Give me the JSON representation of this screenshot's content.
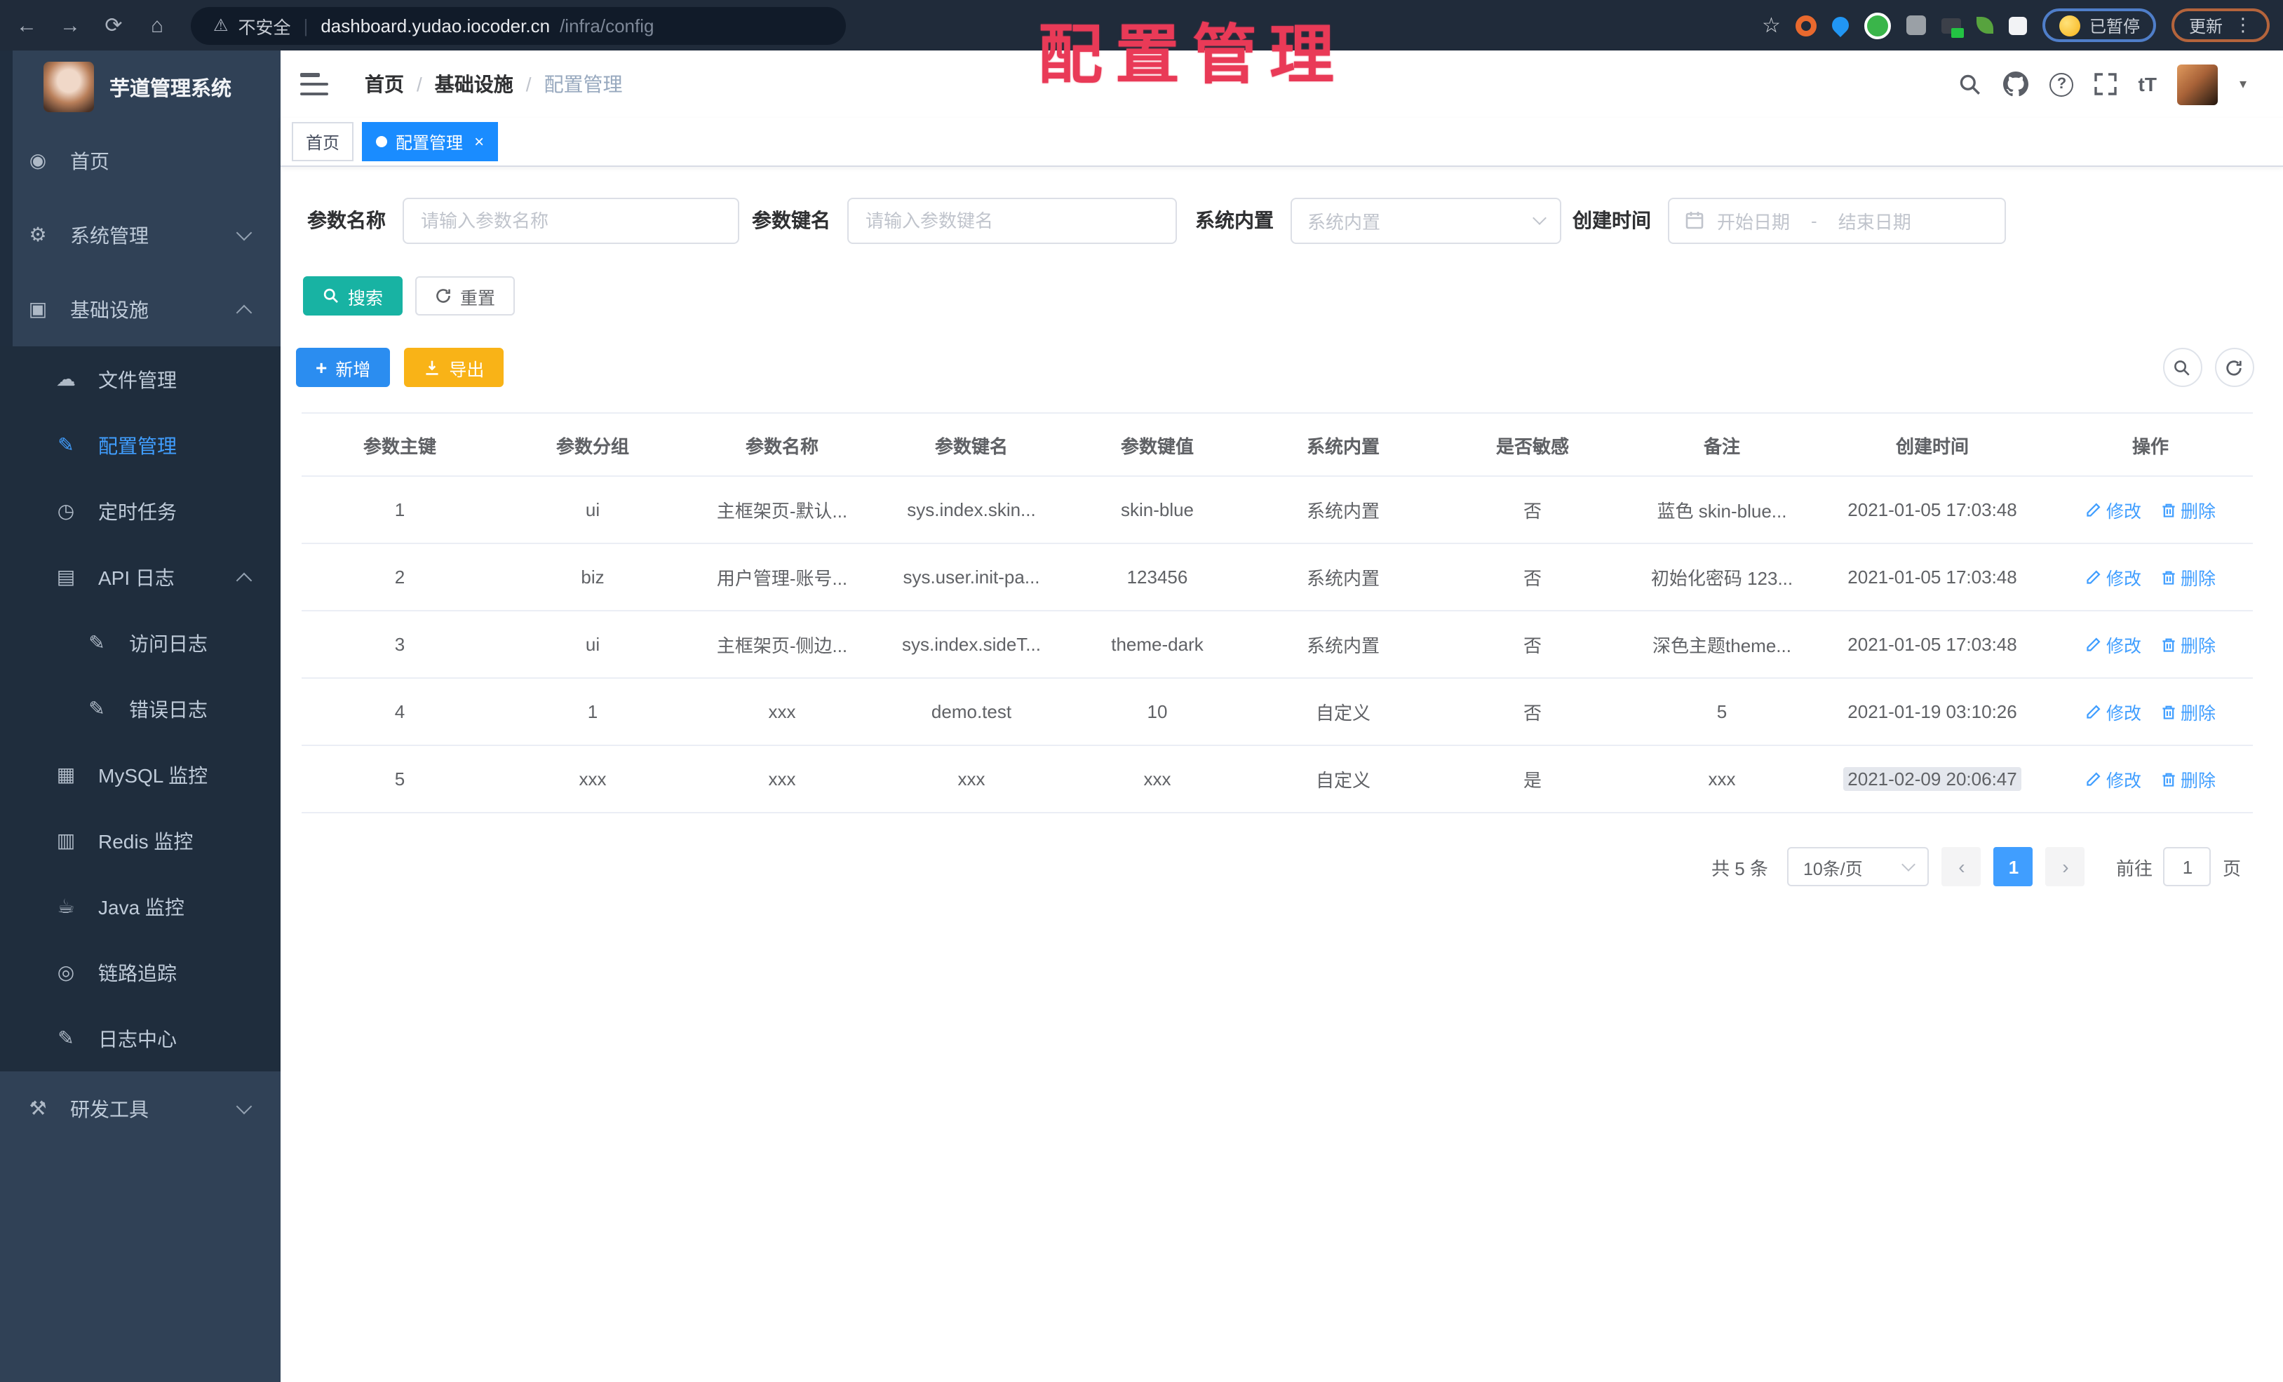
{
  "colors": {
    "accent": "#409eff",
    "tab-active": "#1a8cff",
    "btn-search": "#18b3a3",
    "btn-add": "#2b8df0",
    "btn-export": "#f9b317",
    "toolbar-bg": "#202b3a",
    "urlpill-bg": "#111b29",
    "sidebar-bg": "#304156",
    "sidebar-sub-bg": "#1f2d3d",
    "sidebar-text": "#bfcbd9",
    "stamp": "#e93a57",
    "link": "#409eff"
  },
  "icons": {
    "back": "←",
    "forward": "→",
    "reload": "⟳",
    "home": "⌂",
    "warning": "⚠",
    "star": "☆",
    "overflow": "⋮",
    "caret": "▾",
    "help": "?",
    "font_size": "tT",
    "plus": "+",
    "close": "×",
    "prev": "‹",
    "next": "›"
  },
  "browser": {
    "security_label": "不安全",
    "url_host": "dashboard.yudao.iocoder.cn",
    "url_path": "/infra/config",
    "paused_label": "已暂停",
    "update_label": "更新"
  },
  "stamp": "配置管理",
  "sidebar": {
    "title": "芋道管理系统",
    "items": [
      {
        "id": "home",
        "level": 1,
        "icon": "dashboard-icon",
        "glyph": "◉",
        "label": "首页"
      },
      {
        "id": "system",
        "level": 1,
        "icon": "gear-icon",
        "glyph": "⚙",
        "label": "系统管理",
        "chevron": "down"
      },
      {
        "id": "infra",
        "level": 1,
        "icon": "monitor-icon",
        "glyph": "▣",
        "label": "基础设施",
        "chevron": "up"
      },
      {
        "id": "file",
        "level": 2,
        "sub": true,
        "icon": "cloud-icon",
        "glyph": "☁",
        "label": "文件管理"
      },
      {
        "id": "config",
        "level": 2,
        "sub": true,
        "icon": "edit-square-icon",
        "glyph": "✎",
        "label": "配置管理",
        "active": true
      },
      {
        "id": "job",
        "level": 2,
        "sub": true,
        "icon": "timer-icon",
        "glyph": "◷",
        "label": "定时任务"
      },
      {
        "id": "api-log",
        "level": 2,
        "sub": true,
        "icon": "log-icon",
        "glyph": "▤",
        "label": "API 日志",
        "chevron": "up"
      },
      {
        "id": "access-log",
        "level": 3,
        "sub": true,
        "icon": "edit-note-icon",
        "glyph": "✎",
        "label": "访问日志"
      },
      {
        "id": "error-log",
        "level": 3,
        "sub": true,
        "icon": "edit-note-icon",
        "glyph": "✎",
        "label": "错误日志"
      },
      {
        "id": "mysql",
        "level": 2,
        "sub": true,
        "icon": "database-icon",
        "glyph": "▦",
        "label": "MySQL 监控"
      },
      {
        "id": "redis",
        "level": 2,
        "sub": true,
        "icon": "stack-icon",
        "glyph": "▥",
        "label": "Redis 监控"
      },
      {
        "id": "java",
        "level": 2,
        "sub": true,
        "icon": "coffee-icon",
        "glyph": "☕",
        "label": "Java 监控"
      },
      {
        "id": "trace",
        "level": 2,
        "sub": true,
        "icon": "eye-icon",
        "glyph": "◎",
        "label": "链路追踪"
      },
      {
        "id": "log-center",
        "level": 2,
        "sub": true,
        "icon": "edit-note-icon",
        "glyph": "✎",
        "label": "日志中心"
      },
      {
        "id": "dev-tools",
        "level": 1,
        "icon": "toolbox-icon",
        "glyph": "⚒",
        "label": "研发工具",
        "chevron": "down"
      }
    ]
  },
  "header": {
    "breadcrumb": [
      "首页",
      "基础设施",
      "配置管理"
    ],
    "breadcrumb_separator": "/"
  },
  "tabs": [
    {
      "label": "首页"
    },
    {
      "label": "配置管理",
      "active": true,
      "closable": true
    }
  ],
  "filters": {
    "name_label": "参数名称",
    "name_placeholder": "请输入参数名称",
    "key_label": "参数键名",
    "key_placeholder": "请输入参数键名",
    "type_label": "系统内置",
    "type_placeholder": "系统内置",
    "date_label": "创建时间",
    "date_start": "开始日期",
    "date_separator": "-",
    "date_end": "结束日期",
    "search_label": "搜索",
    "reset_label": "重置",
    "add_label": "新增",
    "export_label": "导出"
  },
  "table": {
    "columns": [
      "参数主键",
      "参数分组",
      "参数名称",
      "参数键名",
      "参数键值",
      "系统内置",
      "是否敏感",
      "备注",
      "创建时间",
      "操作"
    ],
    "rows": [
      {
        "cells": [
          "1",
          "ui",
          "主框架页-默认...",
          "sys.index.skin...",
          "skin-blue",
          "系统内置",
          "否",
          "蓝色 skin-blue...",
          "2021-01-05 17:03:48"
        ]
      },
      {
        "cells": [
          "2",
          "biz",
          "用户管理-账号...",
          "sys.user.init-pa...",
          "123456",
          "系统内置",
          "否",
          "初始化密码 123...",
          "2021-01-05 17:03:48"
        ]
      },
      {
        "cells": [
          "3",
          "ui",
          "主框架页-侧边...",
          "sys.index.sideT...",
          "theme-dark",
          "系统内置",
          "否",
          "深色主题theme...",
          "2021-01-05 17:03:48"
        ]
      },
      {
        "cells": [
          "4",
          "1",
          "xxx",
          "demo.test",
          "10",
          "自定义",
          "否",
          "5",
          "2021-01-19 03:10:26"
        ]
      },
      {
        "cells": [
          "5",
          "xxx",
          "xxx",
          "xxx",
          "xxx",
          "自定义",
          "是",
          "xxx",
          "2021-02-09 20:06:47"
        ],
        "created_highlight": true
      }
    ],
    "actions": [
      {
        "id": "edit",
        "icon": "edit-icon",
        "label": "修改"
      },
      {
        "id": "delete",
        "icon": "delete-icon",
        "label": "删除"
      }
    ]
  },
  "pagination": {
    "total": "共 5 条",
    "page_size": "10条/页",
    "current": "1",
    "goto_label": "前往",
    "goto_value": "1",
    "unit_label": "页"
  }
}
